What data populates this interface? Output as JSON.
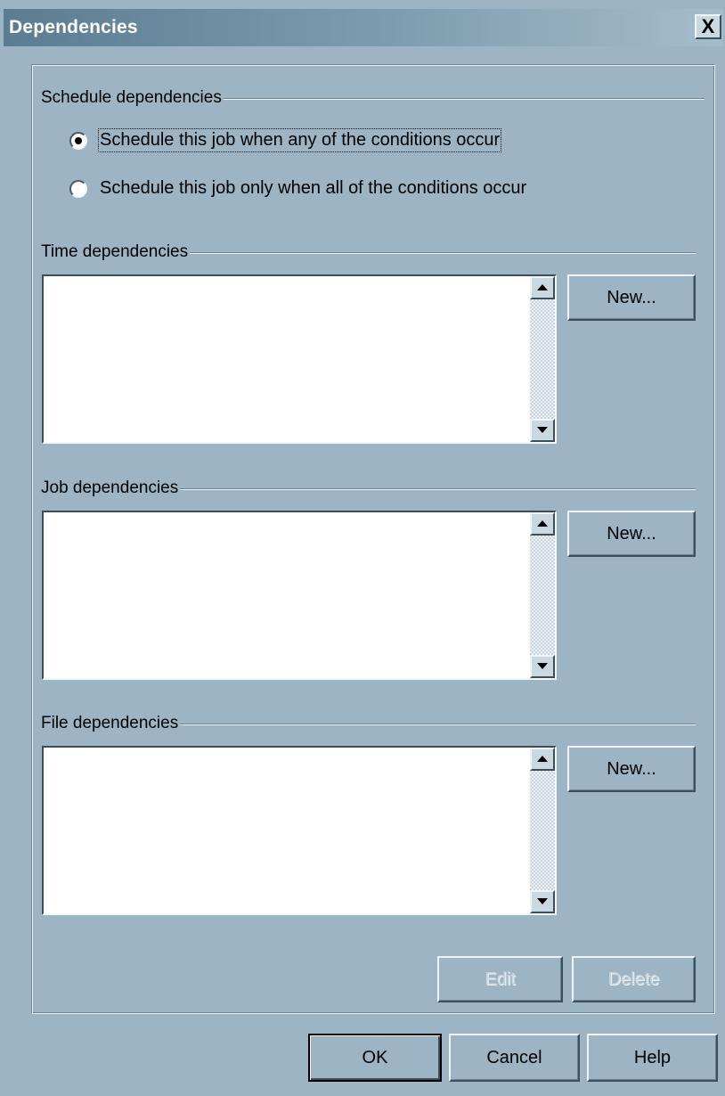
{
  "dialog": {
    "title": "Dependencies",
    "close_label": "X"
  },
  "schedule": {
    "section_label": "Schedule dependencies",
    "options": [
      {
        "label": "Schedule this job when any of the conditions occur",
        "selected": true
      },
      {
        "label": "Schedule this job only when all of the conditions occur",
        "selected": false
      }
    ]
  },
  "time": {
    "section_label": "Time dependencies",
    "new_label": "New...",
    "items": []
  },
  "job": {
    "section_label": "Job dependencies",
    "new_label": "New...",
    "items": []
  },
  "file": {
    "section_label": "File dependencies",
    "new_label": "New...",
    "items": []
  },
  "actions": {
    "edit_label": "Edit",
    "delete_label": "Delete"
  },
  "footer": {
    "ok_label": "OK",
    "cancel_label": "Cancel",
    "help_label": "Help"
  },
  "colors": {
    "dialog_bg": "#9cb4c3",
    "title_text": "#ffffff",
    "disabled_text": "#c8d6df"
  }
}
